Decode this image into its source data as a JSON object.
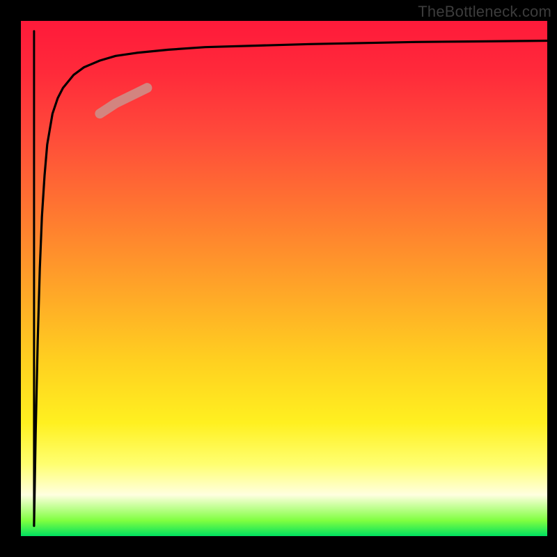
{
  "watermark": "TheBottleneck.com",
  "chart_data": {
    "type": "line",
    "title": "",
    "xlabel": "",
    "ylabel": "",
    "xlim": [
      0,
      100
    ],
    "ylim": [
      0,
      100
    ],
    "grid": false,
    "legend": false,
    "background_gradient": [
      "#ff1a3a",
      "#ff4a3a",
      "#ffa528",
      "#fff020",
      "#ffffe0",
      "#00e060"
    ],
    "series": [
      {
        "name": "bottleneck-curve",
        "color": "#000000",
        "x": [
          2.5,
          2.8,
          3.2,
          3.6,
          4.0,
          4.5,
          5.0,
          6.0,
          7.0,
          8.0,
          10,
          12,
          15,
          18,
          22,
          28,
          35,
          45,
          55,
          65,
          75,
          85,
          95,
          100
        ],
        "y": [
          2,
          20,
          38,
          52,
          62,
          70,
          76,
          82,
          85,
          87,
          89.5,
          91,
          92.3,
          93.2,
          93.8,
          94.4,
          94.9,
          95.2,
          95.5,
          95.7,
          95.9,
          96.0,
          96.1,
          96.15
        ]
      },
      {
        "name": "descending-stub",
        "color": "#000000",
        "x": [
          2.5,
          2.5
        ],
        "y": [
          98,
          2
        ]
      }
    ],
    "annotations": [
      {
        "name": "highlight-segment",
        "type": "segment-highlight",
        "color": "#cf8b86",
        "x_range": [
          15,
          24
        ],
        "y_range": [
          82,
          88
        ]
      }
    ]
  }
}
